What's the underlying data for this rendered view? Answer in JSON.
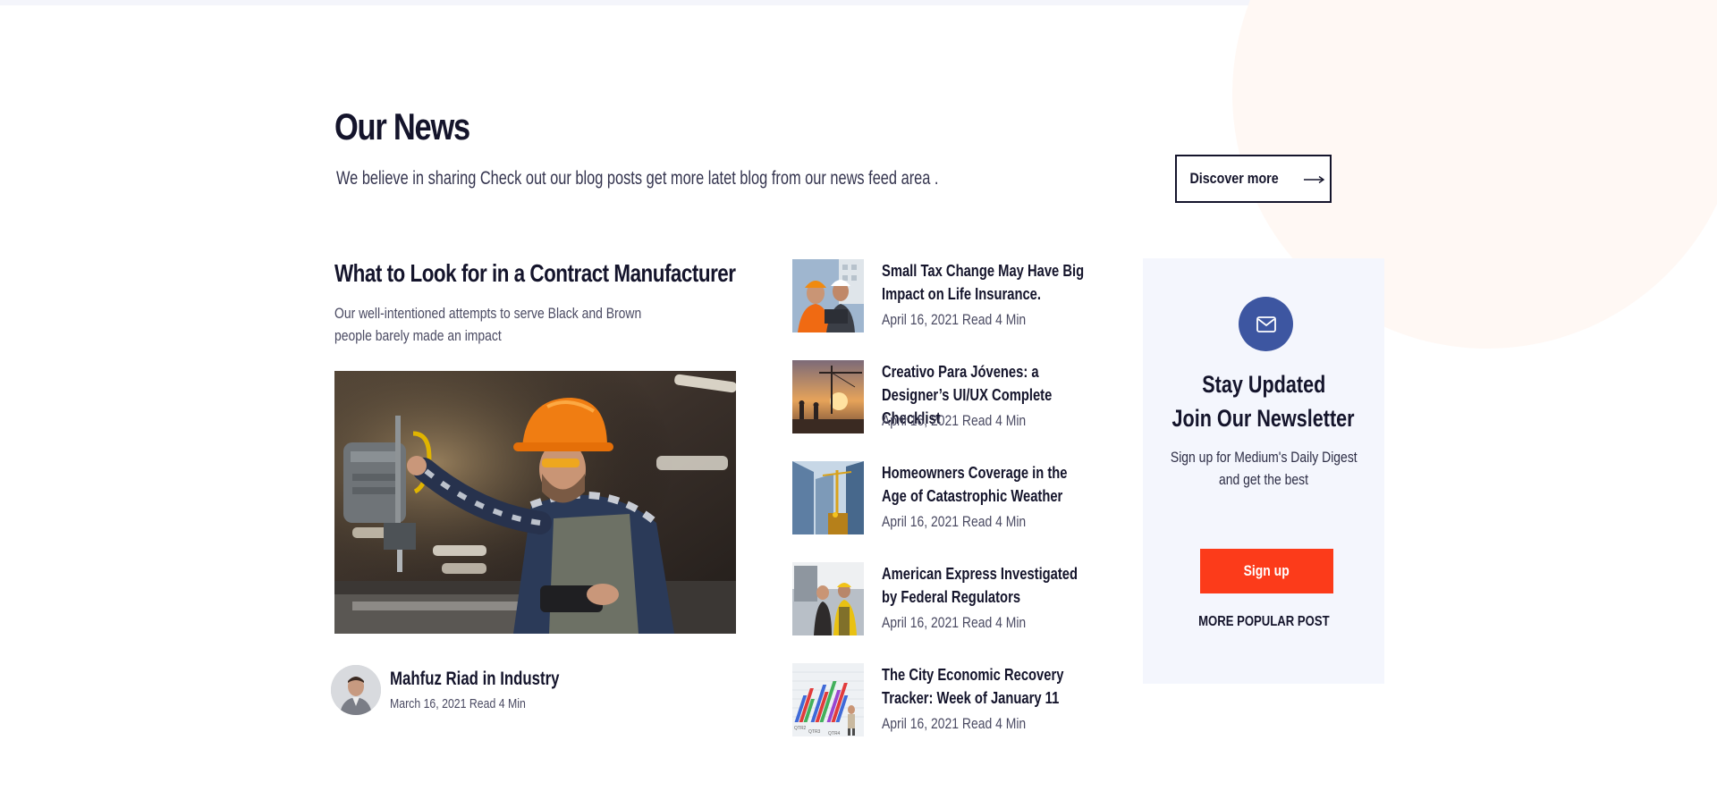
{
  "section": {
    "title": "Our News",
    "subtitle": "We believe in sharing Check out our blog posts get more latet  blog from our news feed area .",
    "discover_label": "Discover more",
    "discover_icon": "arrow-right-icon"
  },
  "featured": {
    "title": "What to Look for in a Contract Manufacturer",
    "description": "Our well-intentioned attempts to serve Black and Brown people barely made an impact",
    "image_icon": "worker-drill-photo",
    "author_name": "Mahfuz Riad in Industry",
    "author_meta": "March 16, 2021  Read 4 Min"
  },
  "posts": [
    {
      "title": "Small Tax Change May Have Big Impact on Life Insurance.",
      "meta": "April 16, 2021  Read 4 Min"
    },
    {
      "title": "Creativo Para Jóvenes: a Designer’s UI/UX Complete Checklist",
      "meta": "April 16, 2021  Read 4 Min"
    },
    {
      "title": "Homeowners Coverage in the Age of Catastrophic Weather",
      "meta": "April 16, 2021  Read 4 Min"
    },
    {
      "title": "American Express Investigated by Federal Regulators",
      "meta": "April 16, 2021  Read 4 Min"
    },
    {
      "title": "The City Economic Recovery Tracker: Week of January 11",
      "meta": "April 16, 2021  Read 4 Min"
    }
  ],
  "thumb_labels": {
    "q2": "QTR2",
    "q3": "QTR3",
    "q4": "QTR4"
  },
  "newsletter": {
    "icon": "envelope-icon",
    "title_line1": "Stay Updated",
    "title_line2": "Join Our Newsletter",
    "desc_line1": "Sign up for Medium's Daily Digest",
    "desc_line2": "and get the best",
    "signup_label": "Sign up",
    "more_label": "MORE POPULAR POST"
  },
  "colors": {
    "accent": "#fc3b1a",
    "mail_circle": "#3d56a1",
    "heading": "#14142b",
    "newsletter_bg": "#f4f6fd"
  }
}
